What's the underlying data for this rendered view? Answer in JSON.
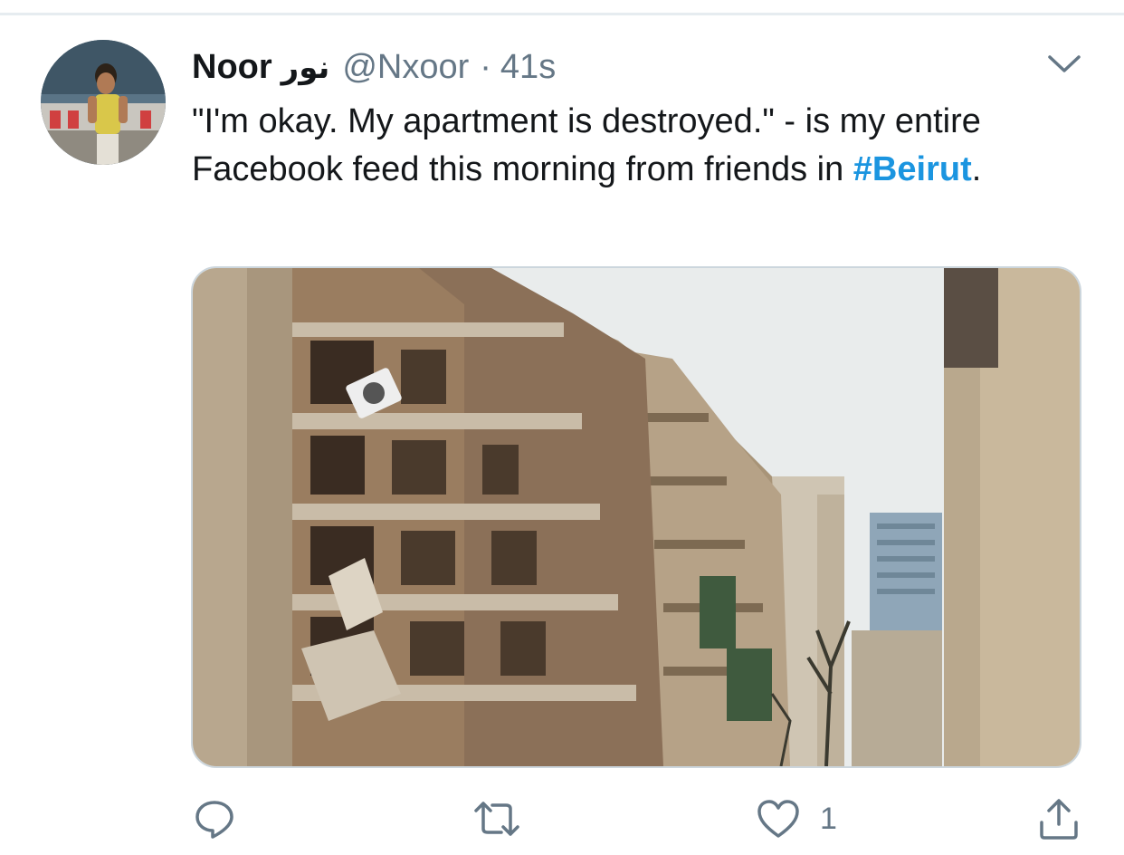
{
  "tweet": {
    "display_name": "Noor",
    "display_name_alt": "نور",
    "handle": "@Nxoor",
    "separator": "·",
    "time": "41s",
    "text_before": "\"I'm okay. My apartment is destroyed.\" - is my entire Facebook feed this morning from friends in ",
    "hashtag": "#Beirut",
    "text_after": ".",
    "media_description_icon": "photo-of-destroyed-apartment-buildings"
  },
  "actions": {
    "reply_icon": "reply-icon",
    "retweet_icon": "retweet-icon",
    "like_icon": "heart-icon",
    "like_count": "1",
    "share_icon": "share-icon"
  },
  "colors": {
    "text": "#14171a",
    "secondary": "#657786",
    "link": "#1b95e0",
    "border": "#e6ecf0"
  }
}
